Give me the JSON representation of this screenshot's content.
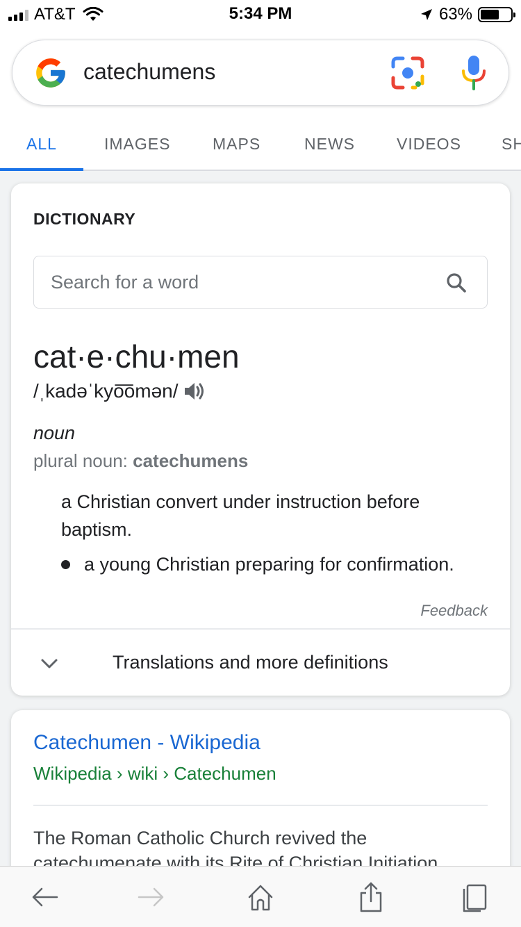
{
  "status_bar": {
    "carrier": "AT&T",
    "time": "5:34 PM",
    "battery": "63%",
    "battery_level": 0.63
  },
  "search": {
    "query": "catechumens",
    "icons": [
      "google-g-icon",
      "lens-icon",
      "mic-icon"
    ]
  },
  "tabs": [
    {
      "label": "ALL",
      "active": true
    },
    {
      "label": "IMAGES"
    },
    {
      "label": "MAPS"
    },
    {
      "label": "NEWS"
    },
    {
      "label": "VIDEOS"
    },
    {
      "label": "SH"
    }
  ],
  "dictionary": {
    "heading": "DICTIONARY",
    "search_placeholder": "Search for a word",
    "headword": "cat·e·chu·men",
    "pronunciation": "/ˌkadəˈkyo͞omən/",
    "part_of_speech": "noun",
    "plural_label": "plural noun:",
    "plural_value": "catechumens",
    "definitions": [
      "a Christian convert under instruction before baptism.",
      "a young Christian preparing for confirmation."
    ],
    "feedback": "Feedback",
    "more_label": "Translations and more definitions"
  },
  "result": {
    "title": "Catechumen - Wikipedia",
    "breadcrumb": "Wikipedia › wiki › Catechumen",
    "snippet_line1": "The Roman Catholic Church revived the",
    "snippet_line2": "catechumenate with its Rite of Christian Initiation"
  },
  "colors": {
    "accent": "#1a73e8",
    "link": "#1967d2",
    "url_green": "#188038",
    "secondary_text": "#70757a"
  },
  "toolbar_icons": [
    "back-arrow-icon",
    "forward-arrow-icon",
    "home-icon",
    "share-icon",
    "tabs-icon"
  ]
}
